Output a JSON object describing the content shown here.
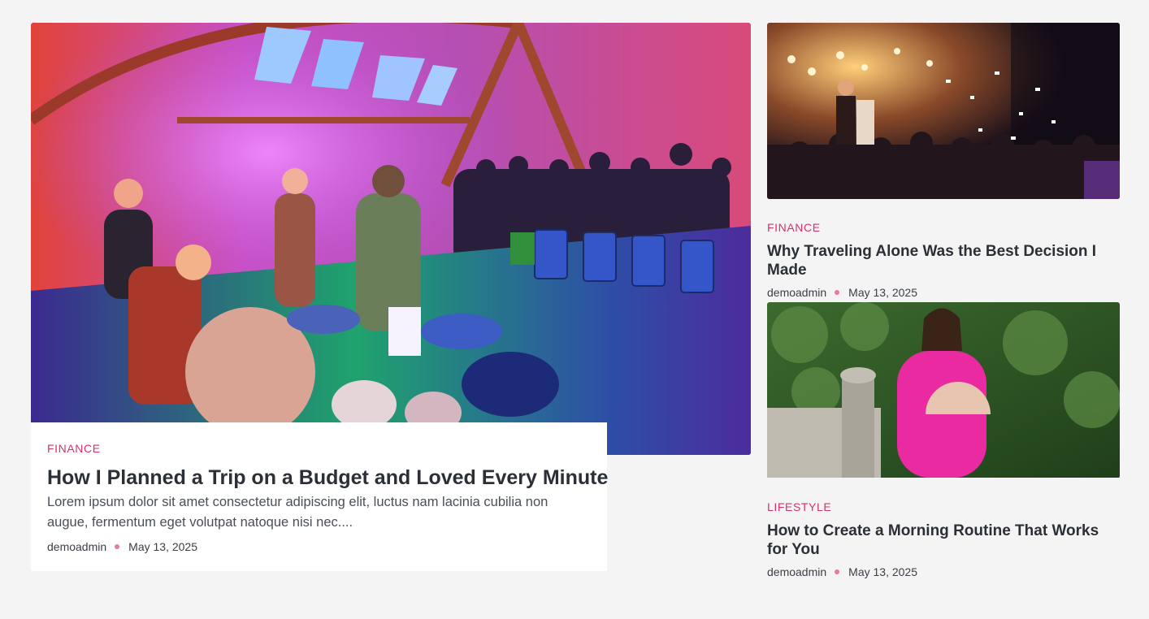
{
  "colors": {
    "accent": "#d2336f",
    "dot": "#e7799f",
    "background": "#f4f4f4"
  },
  "featured": {
    "category": "FINANCE",
    "title": "How I Planned a Trip on a Budget and Loved Every Minute",
    "excerpt": "Lorem ipsum dolor sit amet consectetur adipiscing elit, luctus nam lacinia cubilia non augue, fermentum eget volutpat natoque nisi nec....",
    "author": "demoadmin",
    "date": "May 13, 2025",
    "image": "concert-stage-photo"
  },
  "side_posts": [
    {
      "category": "FINANCE",
      "title": "Why Traveling Alone Was the Best Decision I Made",
      "author": "demoadmin",
      "date": "May 13, 2025",
      "image": "nightclub-party-photo"
    },
    {
      "category": "LIFESTYLE",
      "title": "How to Create a Morning Routine That Works for You",
      "author": "demoadmin",
      "date": "May 13, 2025",
      "image": "woman-pink-dress-fan-photo"
    }
  ]
}
